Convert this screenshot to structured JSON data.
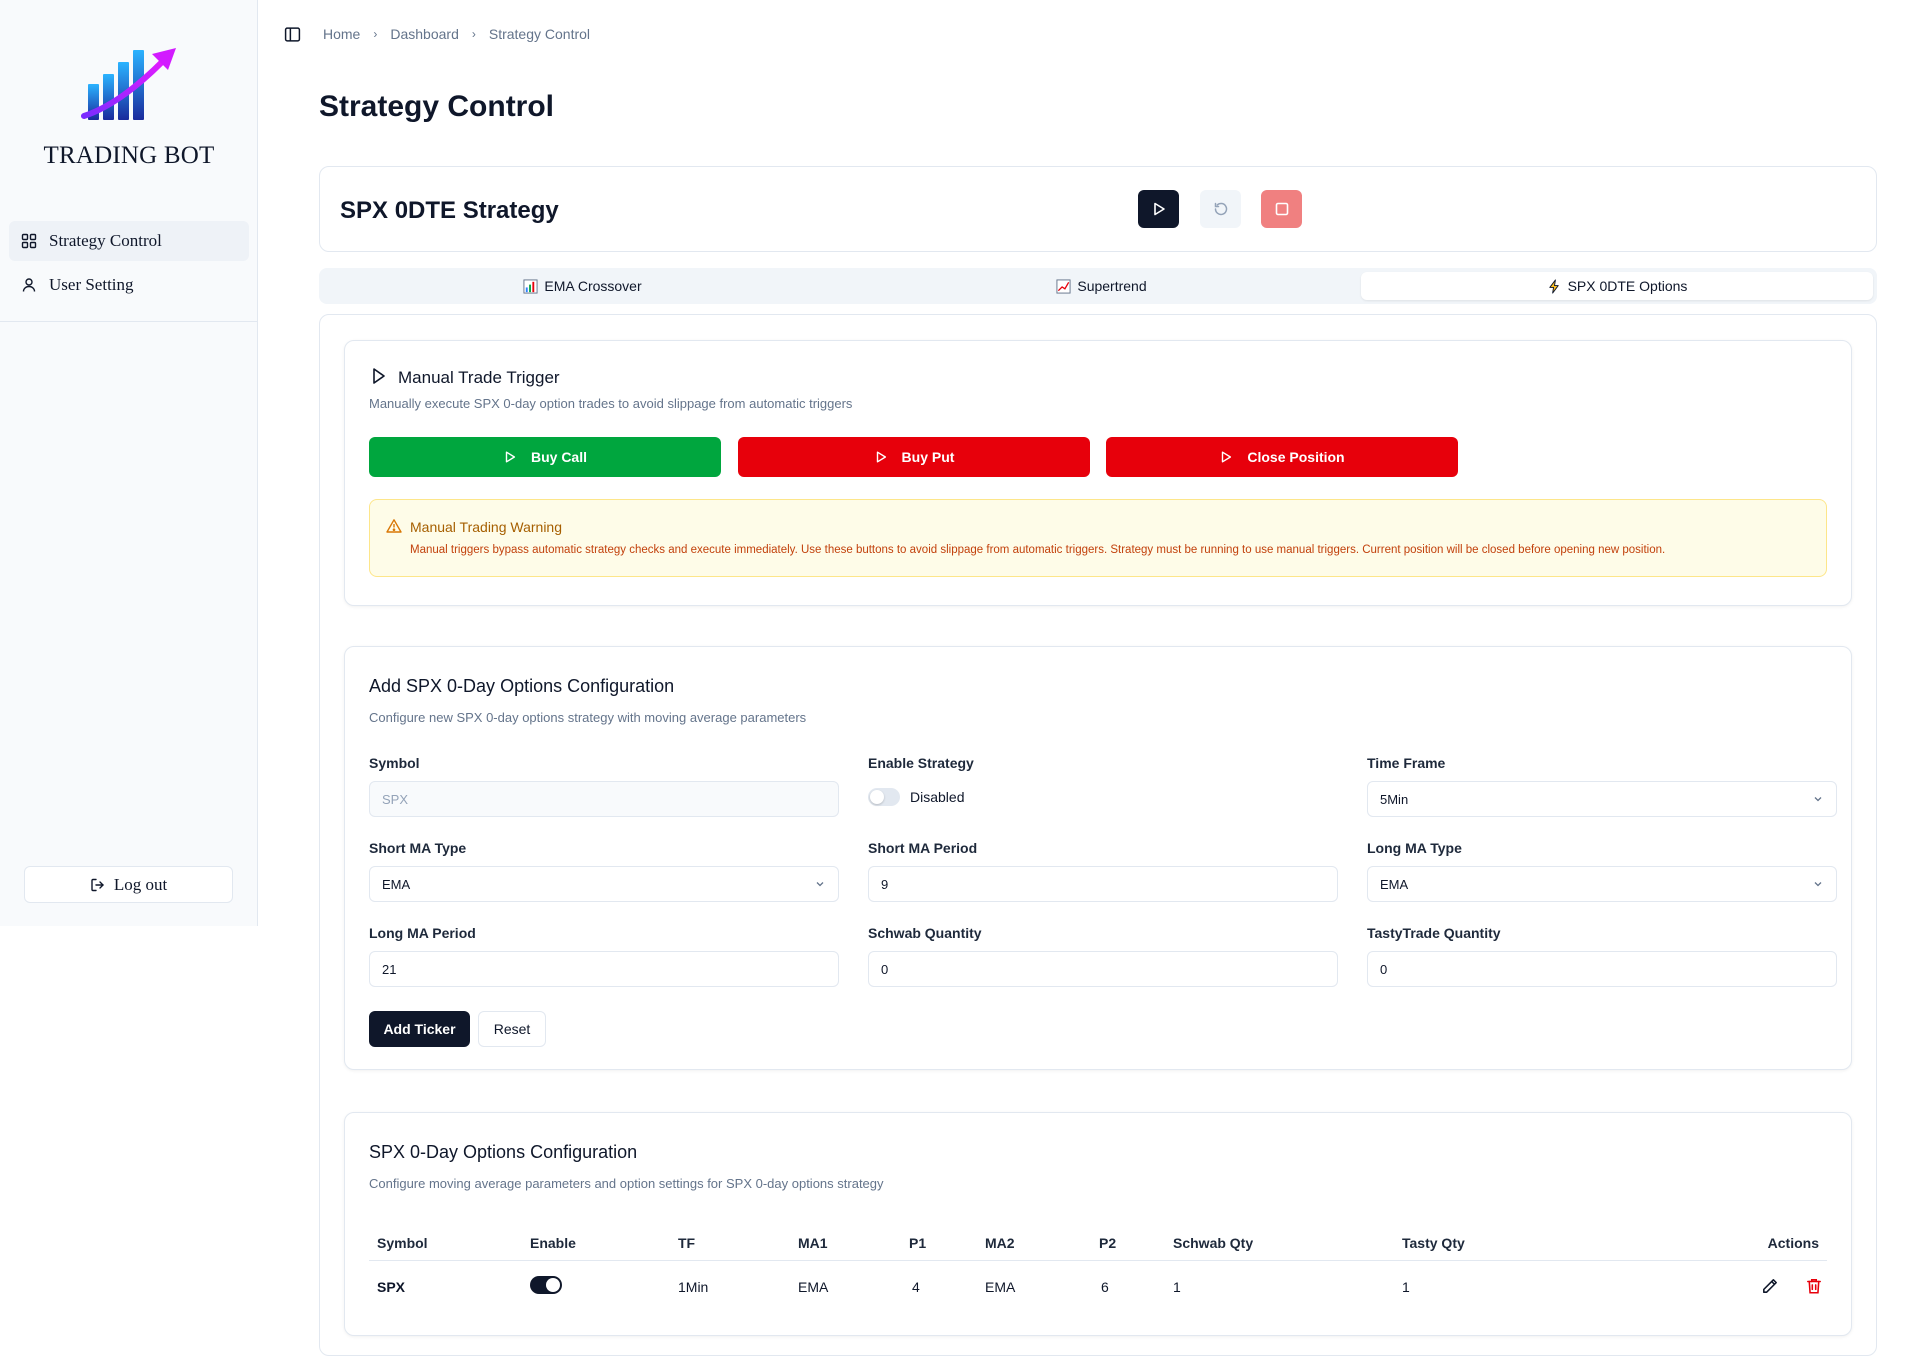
{
  "sidebar": {
    "brand": "TRADING BOT",
    "items": [
      {
        "label": "Strategy Control",
        "icon": "grid-icon"
      },
      {
        "label": "User Setting",
        "icon": "user-icon"
      }
    ],
    "logout_label": "Log out"
  },
  "breadcrumb": [
    "Home",
    "Dashboard",
    "Strategy Control"
  ],
  "page_title": "Strategy Control",
  "strategy": {
    "title": "SPX 0DTE Strategy"
  },
  "tabs": [
    {
      "label": "EMA Crossover",
      "icon": "bar-chart-icon"
    },
    {
      "label": "Supertrend",
      "icon": "trend-chart-icon"
    },
    {
      "label": "SPX 0DTE Options",
      "icon": "lightning-icon"
    }
  ],
  "manual": {
    "title": "Manual Trade Trigger",
    "desc": "Manually execute SPX 0-day option trades to avoid slippage from automatic triggers",
    "buy_call": "Buy Call",
    "buy_put": "Buy Put",
    "close_position": "Close Position",
    "warning_title": "Manual Trading Warning",
    "warning_text": "Manual triggers bypass automatic strategy checks and execute immediately. Use these buttons to avoid slippage from automatic triggers. Strategy must be running to use manual triggers. Current position will be closed before opening new position."
  },
  "add_config": {
    "title": "Add SPX 0-Day Options Configuration",
    "desc": "Configure new SPX 0-day options strategy with moving average parameters",
    "symbol_label": "Symbol",
    "symbol_placeholder": "SPX",
    "enable_label": "Enable Strategy",
    "enable_value": "Disabled",
    "timeframe_label": "Time Frame",
    "timeframe_value": "5Min",
    "short_ma_type_label": "Short MA Type",
    "short_ma_type_value": "EMA",
    "short_ma_period_label": "Short MA Period",
    "short_ma_period_value": "9",
    "long_ma_type_label": "Long MA Type",
    "long_ma_type_value": "EMA",
    "long_ma_period_label": "Long MA Period",
    "long_ma_period_value": "21",
    "schwab_qty_label": "Schwab Quantity",
    "schwab_qty_value": "0",
    "tasty_qty_label": "TastyTrade Quantity",
    "tasty_qty_value": "0",
    "add_button": "Add Ticker",
    "reset_button": "Reset"
  },
  "config_table": {
    "title": "SPX 0-Day Options Configuration",
    "desc": "Configure moving average parameters and option settings for SPX 0-day options strategy",
    "headers": [
      "Symbol",
      "Enable",
      "TF",
      "MA1",
      "P1",
      "MA2",
      "P2",
      "Schwab Qty",
      "Tasty Qty",
      "Actions"
    ],
    "rows": [
      {
        "symbol": "SPX",
        "enabled": true,
        "tf": "1Min",
        "ma1": "EMA",
        "p1": "4",
        "ma2": "EMA",
        "p2": "6",
        "schwab_qty": "1",
        "tasty_qty": "1"
      }
    ]
  },
  "colors": {
    "primary": "#0f172a",
    "buy_call": "#00a63e",
    "buy_put": "#e7000b",
    "close_position": "#e7000b",
    "stop": "#f08080",
    "warning_bg": "#fefce8",
    "delete": "#e7000b"
  }
}
